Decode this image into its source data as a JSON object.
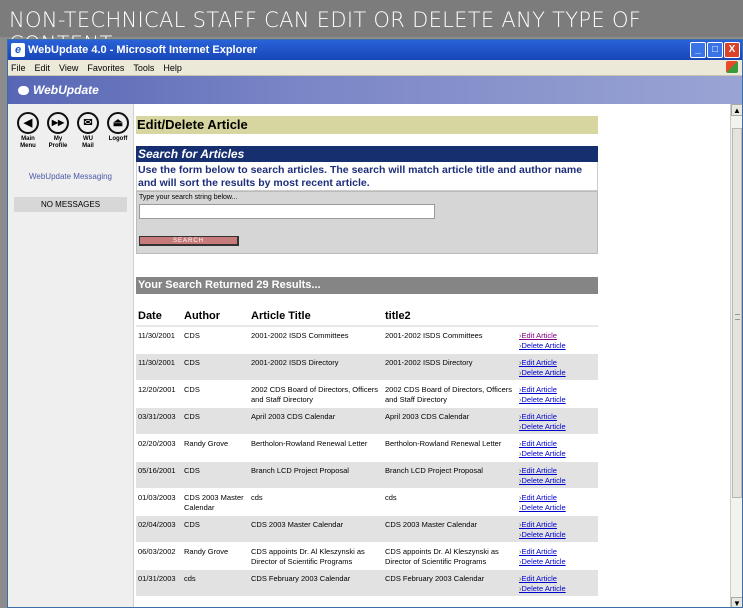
{
  "banner": "NON-TECHNICAL STAFF CAN EDIT OR DELETE ANY TYPE OF CONTENT",
  "window": {
    "title": "WebUpdate 4.0 - Microsoft Internet Explorer",
    "buttons": [
      "_",
      "□",
      "X"
    ]
  },
  "menu": [
    "File",
    "Edit",
    "View",
    "Favorites",
    "Tools",
    "Help"
  ],
  "app": {
    "logo": "WebUpdate"
  },
  "sidebar": {
    "nav": [
      {
        "icon": "back-arrow-icon",
        "glyph": "◀",
        "label1": "Main",
        "label2": "Menu"
      },
      {
        "icon": "forward-profile-icon",
        "glyph": "▶▶",
        "label1": "My",
        "label2": "Profile"
      },
      {
        "icon": "mail-icon",
        "glyph": "✉",
        "label1": "WU",
        "label2": "Mail"
      },
      {
        "icon": "eject-logoff-icon",
        "glyph": "⏏",
        "label1": "Logoff",
        "label2": ""
      }
    ],
    "messaging": "WebUpdate Messaging",
    "messages": "NO MESSAGES"
  },
  "page": {
    "title": "Edit/Delete Article",
    "search_heading": "Search for Articles",
    "instructions": "Use the form below to search articles. The search will match article title and author name and will sort the results by most recent article.",
    "input_label": "Type your search string below...",
    "input_value": "",
    "search_button": "SEARCH",
    "results": "Your Search Returned 29 Results..."
  },
  "table": {
    "headers": [
      "Date",
      "Author",
      "Article Title",
      "title2"
    ],
    "edit_label": "Edit Article",
    "delete_label": "Delete Article",
    "rows": [
      {
        "date": "11/30/2001",
        "author": "CDS",
        "title": "2001-2002 ISDS Committees",
        "title2": "2001-2002 ISDS Committees"
      },
      {
        "date": "11/30/2001",
        "author": "CDS",
        "title": "2001-2002 ISDS Directory",
        "title2": "2001-2002 ISDS Directory"
      },
      {
        "date": "12/20/2001",
        "author": "CDS",
        "title": "2002 CDS Board of Directors, Officers and Staff Directory",
        "title2": "2002 CDS Board of Directors, Officers and Staff Directory"
      },
      {
        "date": "03/31/2003",
        "author": "CDS",
        "title": "April 2003 CDS Calendar",
        "title2": "April 2003 CDS Calendar"
      },
      {
        "date": "02/20/2003",
        "author": "Randy Grove",
        "title": "Bertholon-Rowland Renewal Letter",
        "title2": "Bertholon-Rowland Renewal Letter"
      },
      {
        "date": "05/16/2001",
        "author": "CDS",
        "title": "Branch LCD Project Proposal",
        "title2": "Branch LCD Project Proposal"
      },
      {
        "date": "01/03/2003",
        "author": "CDS 2003 Master Calendar",
        "title": "cds",
        "title2": "cds"
      },
      {
        "date": "02/04/2003",
        "author": "CDS",
        "title": "CDS 2003 Master Calendar",
        "title2": "CDS 2003 Master Calendar"
      },
      {
        "date": "06/03/2002",
        "author": "Randy Grove",
        "title": "CDS appoints Dr. Al Kleszynski as Director of Scientific Programs",
        "title2": "CDS appoints Dr. Al Kleszynski as Director of Scientific Programs"
      },
      {
        "date": "01/31/2003",
        "author": "cds",
        "title": "CDS February 2003 Calendar",
        "title2": "CDS February 2003 Calendar"
      }
    ]
  },
  "colors": {
    "banner": "#7c7c7c",
    "titlebar": "#1f55c8",
    "page_title_bg": "#d8d6a0",
    "search_heading_bg": "#162f6f",
    "results_bg": "#858585",
    "link": "#0000cc"
  }
}
